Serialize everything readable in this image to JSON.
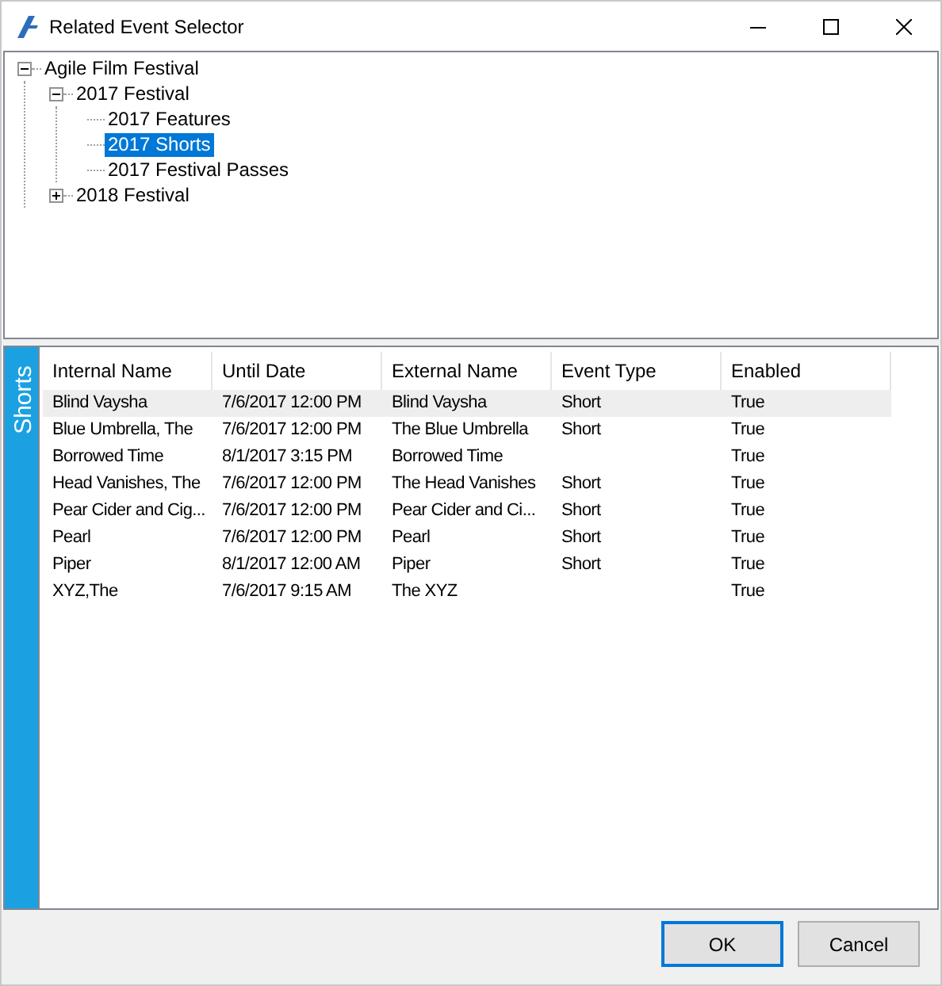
{
  "window": {
    "title": "Related Event Selector"
  },
  "tree": [
    {
      "label": "Agile Film Festival",
      "expanded": true,
      "selected": false,
      "children": [
        {
          "label": "2017 Festival",
          "expanded": true,
          "selected": false,
          "children": [
            {
              "label": "2017 Features",
              "selected": false
            },
            {
              "label": "2017 Shorts",
              "selected": true
            },
            {
              "label": "2017 Festival Passes",
              "selected": false
            }
          ]
        },
        {
          "label": "2018 Festival",
          "expanded": false,
          "selected": false
        }
      ]
    }
  ],
  "side_tab": {
    "label": "Shorts"
  },
  "table": {
    "columns": [
      "Internal Name",
      "Until Date",
      "External Name",
      "Event Type",
      "Enabled"
    ],
    "rows": [
      {
        "cells": [
          "Blind Vaysha",
          "7/6/2017 12:00 PM",
          "Blind Vaysha",
          "Short",
          "True"
        ],
        "selected": true
      },
      {
        "cells": [
          "Blue Umbrella, The",
          "7/6/2017 12:00 PM",
          "The Blue Umbrella",
          "Short",
          "True"
        ],
        "selected": false
      },
      {
        "cells": [
          "Borrowed Time",
          "8/1/2017 3:15 PM",
          "Borrowed Time",
          "",
          "True"
        ],
        "selected": false
      },
      {
        "cells": [
          "Head Vanishes, The",
          "7/6/2017 12:00 PM",
          "The Head Vanishes",
          "Short",
          "True"
        ],
        "selected": false
      },
      {
        "cells": [
          "Pear Cider and Cig...",
          "7/6/2017 12:00 PM",
          "Pear Cider and Ci...",
          "Short",
          "True"
        ],
        "selected": false
      },
      {
        "cells": [
          "Pearl",
          "7/6/2017 12:00 PM",
          "Pearl",
          "Short",
          "True"
        ],
        "selected": false
      },
      {
        "cells": [
          "Piper",
          "8/1/2017 12:00 AM",
          "Piper",
          "Short",
          "True"
        ],
        "selected": false
      },
      {
        "cells": [
          "XYZ,The",
          "7/6/2017 9:15 AM",
          "The XYZ",
          "",
          "True"
        ],
        "selected": false
      }
    ]
  },
  "buttons": [
    {
      "label": "OK",
      "default": true
    },
    {
      "label": "Cancel",
      "default": false
    }
  ]
}
